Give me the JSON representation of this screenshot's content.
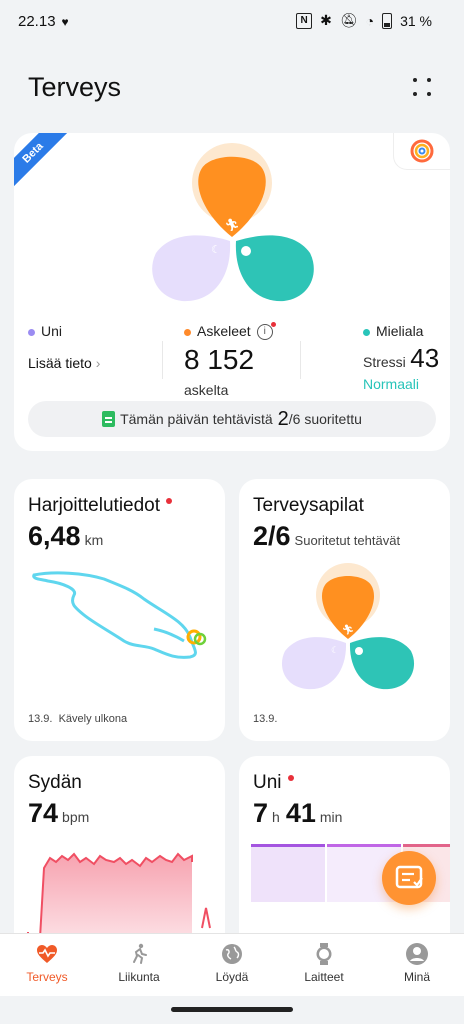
{
  "status_bar": {
    "time": "22.13",
    "battery": "31 %"
  },
  "header": {
    "title": "Terveys"
  },
  "summary": {
    "badge": "Beta",
    "sleep": {
      "label": "Uni",
      "action": "Lisää tieto",
      "color": "#9b8cf2"
    },
    "steps": {
      "label": "Askeleet",
      "value": "8 152",
      "unit": "askelta",
      "color": "#ff8a2a"
    },
    "mood": {
      "label": "Mieliala",
      "stress_label": "Stressi",
      "stress_value": "43",
      "status": "Normaali",
      "color": "#28c4b9"
    },
    "tasks": {
      "prefix": "Tämän päivän tehtävistä",
      "done": "2",
      "total_suffix": "/6 suoritettu"
    }
  },
  "exercise_card": {
    "title": "Harjoittelutiedot",
    "value": "6,48",
    "unit": "km",
    "date": "13.9.",
    "activity": "Kävely ulkona"
  },
  "health_clover_card": {
    "title": "Terveysapilat",
    "value": "2/6",
    "subtitle": "Suoritetut tehtävät",
    "date": "13.9."
  },
  "heart_card": {
    "title": "Sydän",
    "value": "74",
    "unit": "bpm"
  },
  "sleep_card": {
    "title": "Uni",
    "hours": "7",
    "hours_unit": "h",
    "minutes": "41",
    "minutes_unit": "min"
  },
  "bottom_nav": [
    {
      "label": "Terveys",
      "icon": "heart-pulse-icon",
      "active": true
    },
    {
      "label": "Liikunta",
      "icon": "running-person-icon",
      "active": false
    },
    {
      "label": "Löydä",
      "icon": "globe-icon",
      "active": false
    },
    {
      "label": "Laitteet",
      "icon": "watch-icon",
      "active": false
    },
    {
      "label": "Minä",
      "icon": "user-avatar-icon",
      "active": false
    }
  ],
  "colors": {
    "accent": "#f05a28",
    "teal": "#28c4b9",
    "orange": "#ff9332",
    "lilac": "#d9d2fb",
    "heart_red": "#f04f63",
    "sleep_purple": "#a455e0"
  }
}
